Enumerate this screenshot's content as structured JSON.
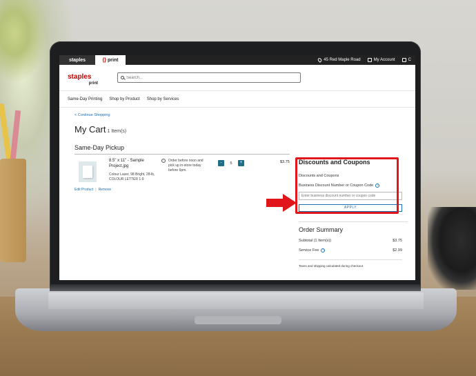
{
  "colors": {
    "brand_red": "#cc0000",
    "accent_blue": "#1a6fb3",
    "qty_button": "#1f6f87",
    "annotation_red": "#e0161b"
  },
  "topbar": {
    "brand_staples": "staples",
    "brand_print": "print",
    "store_address": "45 Red Maple Road",
    "account": "My Account",
    "cart_cut": "C"
  },
  "header": {
    "logo_word": "staples",
    "logo_sub": "print",
    "search_placeholder": "Search..."
  },
  "nav": {
    "items": [
      "Same-Day Printing",
      "Shop by Product",
      "Shop by Services"
    ]
  },
  "cart": {
    "continue_link": "< Continue Shopping",
    "title": "My Cart",
    "item_count": "1 Item(s)",
    "section": "Same-Day Pickup",
    "item": {
      "name": "8.5\" x 11\" - Sample Project.jpg",
      "description": "Colour Laser, 98 Bright, 28-lb, COLOUR LETTER 1-9",
      "note": "Order before noon and pick up in-store today before 6pm.",
      "quantity": "5",
      "minus": "-",
      "plus": "+",
      "price": "$3.75",
      "edit_link": "Edit Product",
      "remove_link": "Remove"
    }
  },
  "discounts": {
    "title": "Discounts and Coupons",
    "subtitle": "Discounts and Coupons",
    "field_label": "Business Discount Number or Coupon Code",
    "field_placeholder": "Enter business discount number or coupon code",
    "apply_label": "APPLY"
  },
  "summary": {
    "title": "Order Summary",
    "subtotal_label": "Subtotal (1 Item(s))",
    "subtotal_value": "$3.75",
    "fee_label": "Service Fee",
    "fee_value": "$2.99",
    "tax_note": "Taxes and shipping calculated during checkout"
  }
}
